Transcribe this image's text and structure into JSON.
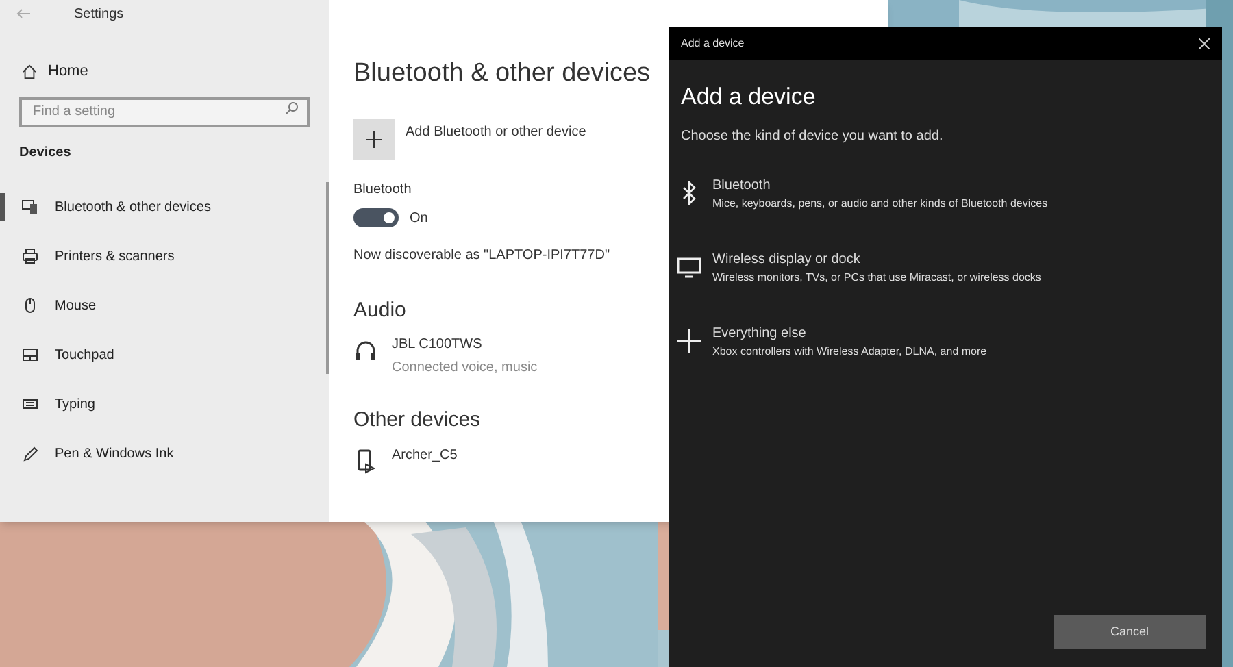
{
  "settings_window": {
    "title": "Settings",
    "sidebar": {
      "home": "Home",
      "search": {
        "placeholder": "Find a setting"
      },
      "section": "Devices",
      "items": [
        {
          "label": "Bluetooth & other devices",
          "selected": true
        },
        {
          "label": "Printers & scanners",
          "selected": false
        },
        {
          "label": "Mouse",
          "selected": false
        },
        {
          "label": "Touchpad",
          "selected": false
        },
        {
          "label": "Typing",
          "selected": false
        },
        {
          "label": "Pen & Windows Ink",
          "selected": false
        }
      ]
    },
    "content": {
      "heading": "Bluetooth & other devices",
      "add_button": "Add Bluetooth or other device",
      "bluetooth": {
        "label": "Bluetooth",
        "on": true,
        "state_text": "On"
      },
      "discoverable": "Now discoverable as \"LAPTOP-IPI7T77D\"",
      "sections": [
        {
          "title": "Audio",
          "devices": [
            {
              "name": "JBL C100TWS",
              "status": "Connected voice, music"
            }
          ]
        },
        {
          "title": "Other devices",
          "devices": [
            {
              "name": "Archer_C5"
            }
          ]
        }
      ]
    }
  },
  "dialog": {
    "title": "Add a device",
    "heading": "Add a device",
    "subtitle": "Choose the kind of device you want to add.",
    "options": [
      {
        "title": "Bluetooth",
        "description": "Mice, keyboards, pens, or audio and other kinds of Bluetooth devices"
      },
      {
        "title": "Wireless display or dock",
        "description": "Wireless monitors, TVs, or PCs that use Miracast, or wireless docks"
      },
      {
        "title": "Everything else",
        "description": "Xbox controllers with Wireless Adapter, DLNA, and more"
      }
    ],
    "cancel": "Cancel"
  }
}
